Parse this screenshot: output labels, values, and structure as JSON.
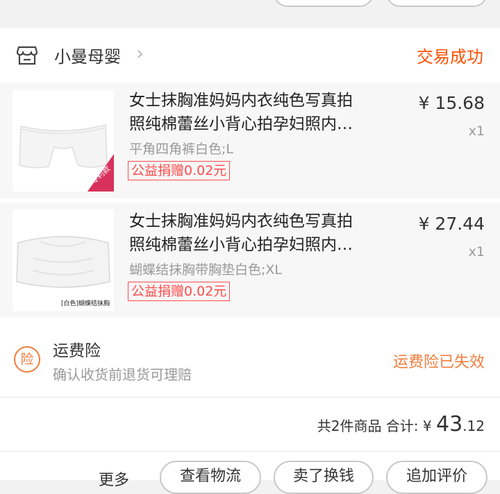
{
  "shop": {
    "name": "小曼母婴",
    "status": "交易成功"
  },
  "items": [
    {
      "title_line1": "女士抹胸准妈妈内衣纯色写真拍",
      "title_line2": "照纯棉蕾丝小背心拍孕妇照内…",
      "sku": "平角四角裤白色;L",
      "donation": "公益捐赠0.02元",
      "price": "¥ 15.68",
      "qty": "x1",
      "thumb_badge": "专利款"
    },
    {
      "title_line1": "女士抹胸准妈妈内衣纯色写真拍",
      "title_line2": "照纯棉蕾丝小背心拍孕妇照内…",
      "sku": "蝴蝶结抹胸带胸垫白色;XL",
      "donation": "公益捐赠0.02元",
      "price": "¥ 27.44",
      "qty": "x1",
      "thumb_caption": "[白色]蝴蝶结抹胸"
    }
  ],
  "insurance": {
    "badge": "险",
    "title": "运费险",
    "desc": "确认收货前退货可理赔",
    "status": "运费险已失效"
  },
  "summary": {
    "count_text": "共2件商品 合计: ",
    "currency": "¥ ",
    "amount_int": "43",
    "amount_dec": ".12"
  },
  "actions": {
    "more": "更多",
    "logistics": "查看物流",
    "resell": "卖了换钱",
    "review": "追加评价"
  },
  "colors": {
    "accent": "#ff5000",
    "insurance": "#f07d3c",
    "tag": "#ff4b4b"
  }
}
